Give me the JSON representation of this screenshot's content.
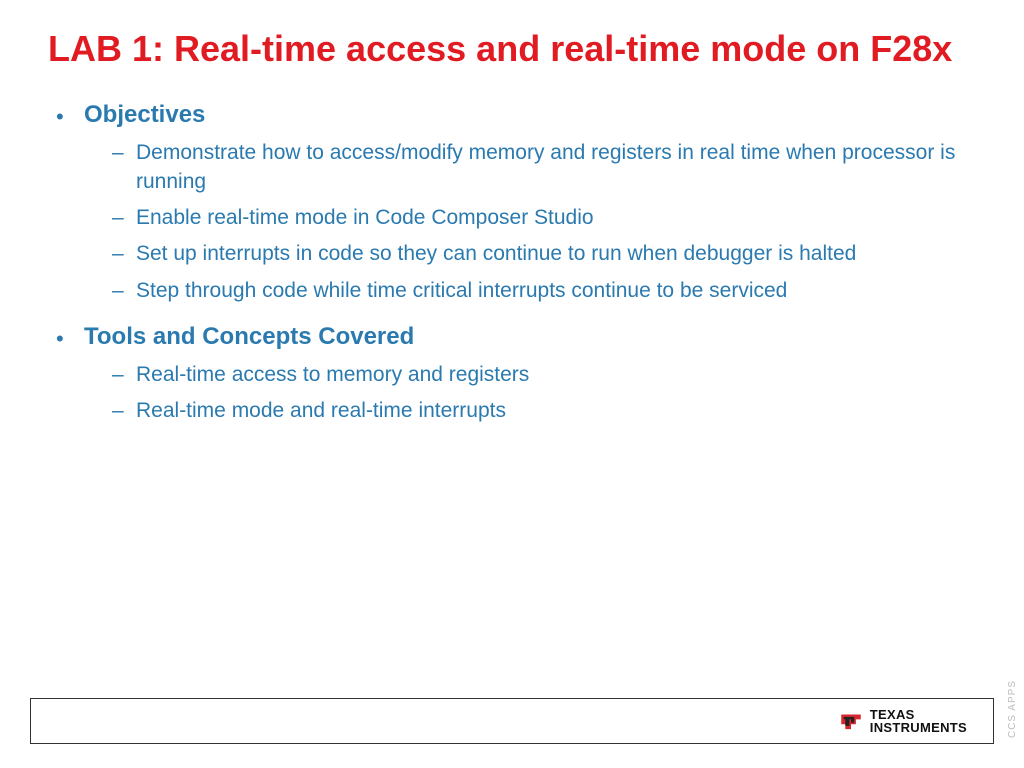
{
  "title": "LAB 1: Real-time access and real-time mode on F28x",
  "sections": [
    {
      "heading": "Objectives",
      "items": [
        "Demonstrate how to access/modify memory and registers in real time when processor is running",
        "Enable real-time mode in Code Composer Studio",
        "Set up interrupts in code so they can continue to run when debugger is halted",
        "Step through code while time critical interrupts continue to be serviced"
      ]
    },
    {
      "heading": "Tools and Concepts Covered",
      "items": [
        "Real-time access to memory and registers",
        "Real-time mode and real-time interrupts"
      ]
    }
  ],
  "footer": {
    "brand_line1": "TEXAS",
    "brand_line2": "INSTRUMENTS"
  },
  "side_label": "CCS APPS"
}
